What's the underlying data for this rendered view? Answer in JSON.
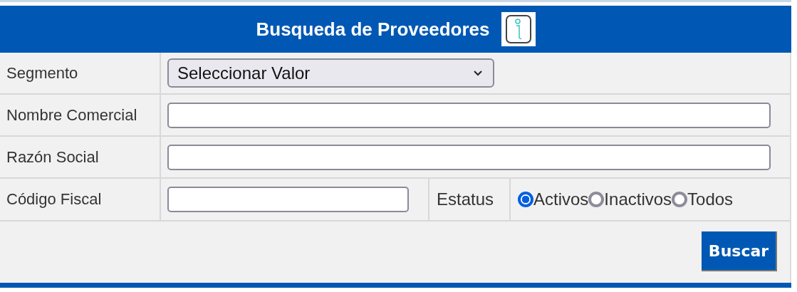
{
  "header": {
    "title": "Busqueda de Proveedores"
  },
  "fields": [
    {
      "kind": "select",
      "label": "Segmento",
      "value": "Seleccionar Valor"
    },
    {
      "kind": "text",
      "label": "Nombre Comercial"
    },
    {
      "kind": "text",
      "label": "Razón Social"
    },
    {
      "kind": "short",
      "label": "Código Fiscal"
    }
  ],
  "status": {
    "label": "Estatus",
    "options": [
      {
        "label": "Activos",
        "selected": true
      },
      {
        "label": "Inactivos",
        "selected": false
      },
      {
        "label": "Todos",
        "selected": false
      }
    ]
  },
  "buttons": [
    "Buscar"
  ]
}
